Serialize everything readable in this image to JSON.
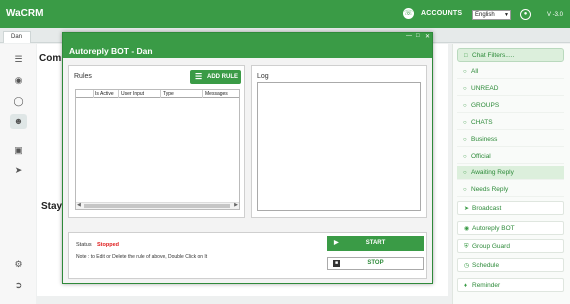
{
  "app": {
    "title": "WaCRM",
    "accounts_label": "ACCOUNTS",
    "language": "English",
    "version": "V -3.0"
  },
  "tabs": [
    {
      "label": "Dan"
    }
  ],
  "background": {
    "heading_1": "Comm",
    "heading_2": "Stay"
  },
  "sidebar": {
    "items": [
      {
        "label": "Chat Filters.....",
        "icon": "chat-filter-icon"
      },
      {
        "label": "All",
        "icon": "chat-bubble-icon"
      },
      {
        "label": "UNREAD",
        "icon": "chat-bubble-icon"
      },
      {
        "label": "GROUPS",
        "icon": "chat-bubble-icon"
      },
      {
        "label": "CHATS",
        "icon": "chat-bubble-icon"
      },
      {
        "label": "Business",
        "icon": "chat-bubble-icon"
      },
      {
        "label": "Official",
        "icon": "chat-bubble-icon"
      },
      {
        "label": "Awaiting Reply",
        "icon": "chat-bubble-icon"
      },
      {
        "label": "Needs Reply",
        "icon": "chat-bubble-icon"
      },
      {
        "label": "Broadcast",
        "icon": "send-icon"
      },
      {
        "label": "Autoreply BOT",
        "icon": "bot-icon"
      },
      {
        "label": "Group Guard",
        "icon": "shield-icon"
      },
      {
        "label": "Schedule",
        "icon": "clock-icon"
      },
      {
        "label": "Reminder",
        "icon": "bell-icon"
      }
    ]
  },
  "modal": {
    "title": "Autoreply BOT - Dan",
    "rules_label": "Rules",
    "add_rule_label": "ADD RULE",
    "log_label": "Log",
    "table_headers": [
      "Is Active",
      "User Input",
      "Type",
      "Messages"
    ],
    "status_label": "Status",
    "status_value": "Stopped",
    "note": "Note : to Edit or Delete the rule of above, Double Click on It",
    "start_label": "START",
    "stop_label": "STOP"
  },
  "colors": {
    "brand_green": "#3a9b46",
    "stopped_red": "#e02020"
  }
}
